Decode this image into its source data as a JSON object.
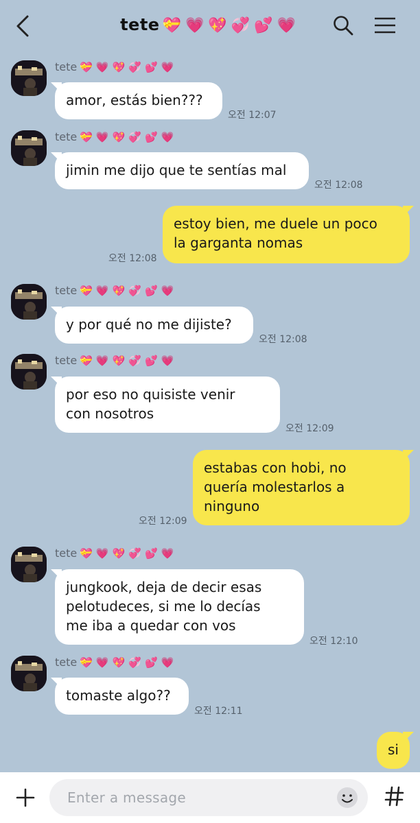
{
  "header": {
    "title": "tete",
    "title_hearts": "💝💗💖💞💕💗",
    "icons": [
      "back-arrow-icon",
      "search-icon",
      "menu-icon"
    ]
  },
  "messages": [
    {
      "id": "m1",
      "side": "in",
      "sender": "tete",
      "sender_hearts": "💝💗💖💞💕💗",
      "lines": [
        "amor, estás bien???"
      ],
      "time": "오전 12:07"
    },
    {
      "id": "m2",
      "side": "in",
      "sender": "tete",
      "sender_hearts": "💝💗💖💞💕💗",
      "lines": [
        "jimin me dijo que te sentías mal"
      ],
      "time": "오전 12:08"
    },
    {
      "id": "m3",
      "side": "out",
      "lines": [
        "estoy bien, me duele un poco",
        "la garganta nomas"
      ],
      "time": "오전 12:08"
    },
    {
      "id": "m4",
      "side": "in",
      "sender": "tete",
      "sender_hearts": "💝💗💖💞💕💗",
      "lines": [
        "y por qué no me dijiste?"
      ],
      "time": "오전 12:08"
    },
    {
      "id": "m5",
      "side": "in",
      "sender": "tete",
      "sender_hearts": "💝💗💖💞💕💗",
      "lines": [
        "por eso no quisiste venir",
        "con nosotros"
      ],
      "time": "오전 12:09"
    },
    {
      "id": "m6",
      "side": "out",
      "lines": [
        "estabas con hobi, no",
        "quería molestarlos a",
        "ninguno"
      ],
      "time": "오전 12:09"
    },
    {
      "id": "m7",
      "side": "in",
      "sender": "tete",
      "sender_hearts": "💝💗💖💞💕💗",
      "lines": [
        "jungkook, deja de decir esas",
        "pelotudeces, si me lo decías",
        "me iba a quedar con vos"
      ],
      "time": "오전 12:10"
    },
    {
      "id": "m8",
      "side": "in",
      "sender": "tete",
      "sender_hearts": "💝💗💖💞💕💗",
      "lines": [
        "tomaste algo??"
      ],
      "time": "오전 12:11"
    },
    {
      "id": "m9",
      "side": "out",
      "lines": [
        "si"
      ],
      "time": ""
    }
  ],
  "composer": {
    "placeholder": "Enter a message",
    "icons": [
      "plus-icon",
      "emoji-icon",
      "hashtag-icon"
    ]
  },
  "colors": {
    "background": "#b2c5d6",
    "outgoing_bubble": "#f8e64c",
    "incoming_bubble": "#ffffff"
  }
}
